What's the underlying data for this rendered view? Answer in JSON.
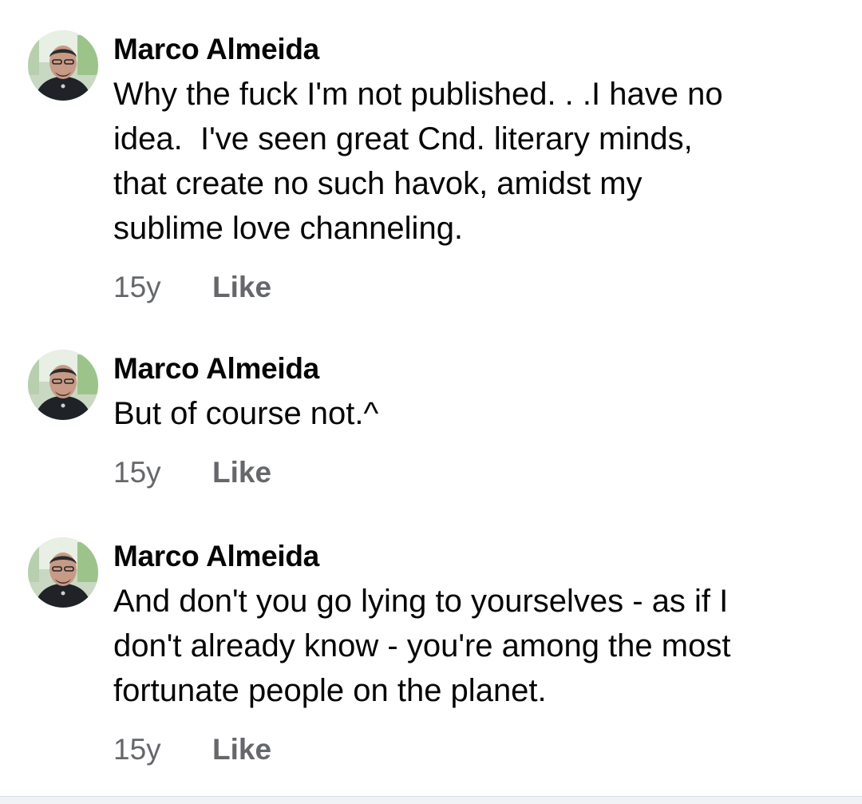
{
  "comments": [
    {
      "author": "Marco Almeida",
      "text_lines": [
        "Why the fuck I'm not published. . .I have no",
        "idea.  I've seen great Cnd. literary minds,",
        "that create no such havok, amidst my",
        "sublime love channeling."
      ],
      "time": "15y",
      "like_label": "Like",
      "avatar_icon": "profile-photo"
    },
    {
      "author": "Marco Almeida",
      "text_lines": [
        "But of course not.^"
      ],
      "time": "15y",
      "like_label": "Like",
      "avatar_icon": "profile-photo"
    },
    {
      "author": "Marco Almeida",
      "text_lines": [
        "And don't you go lying to yourselves - as if I",
        "don't already know - you're among the most",
        "fortunate people on the planet."
      ],
      "time": "15y",
      "like_label": "Like",
      "avatar_icon": "profile-photo"
    }
  ],
  "colors": {
    "text": "#050505",
    "meta": "#65676b",
    "background": "#ffffff"
  }
}
